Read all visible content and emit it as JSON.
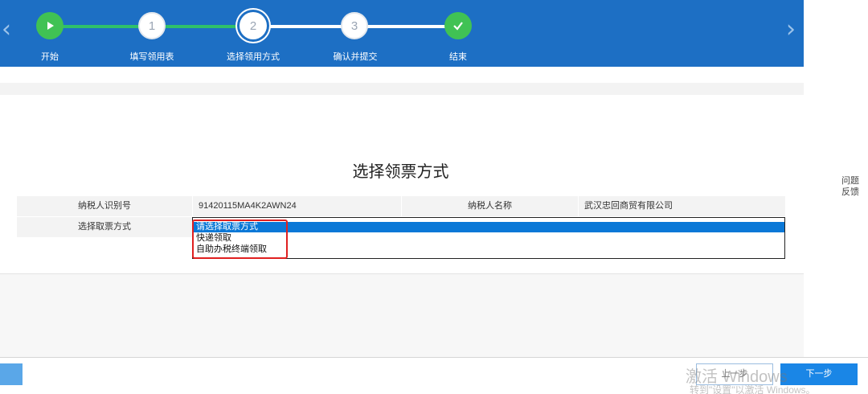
{
  "wizard": {
    "steps": [
      {
        "label": "开始",
        "number": ""
      },
      {
        "label": "填写领用表",
        "number": "1"
      },
      {
        "label": "选择领用方式",
        "number": "2"
      },
      {
        "label": "确认并提交",
        "number": "3"
      },
      {
        "label": "结束",
        "number": ""
      }
    ],
    "prev_icon": "chevron-left-icon",
    "next_icon": "chevron-right-icon",
    "start_icon": "play-icon",
    "end_icon": "check-icon"
  },
  "feedback": {
    "line1": "问题",
    "line2": "反馈"
  },
  "page": {
    "title": "选择领票方式"
  },
  "info": {
    "taxpayer_id_label": "纳税人识别号",
    "taxpayer_id_value": "91420115MA4K2AWN24",
    "taxpayer_name_label": "纳税人名称",
    "taxpayer_name_value": "武汉忠回商贸有限公司",
    "pickup_method_label": "选择取票方式"
  },
  "pickup_options": [
    "请选择取票方式",
    "快递领取",
    "自助办税终端领取"
  ],
  "footer": {
    "prev_label": "上一步",
    "next_label": "下一步"
  },
  "watermark": {
    "line1": "激活 Windows",
    "line2": "转到\"设置\"以激活 Windows。"
  },
  "colors": {
    "accent": "#1d6fc4",
    "success": "#40c254",
    "selected": "#0a78d7",
    "highlight": "#e02020"
  }
}
